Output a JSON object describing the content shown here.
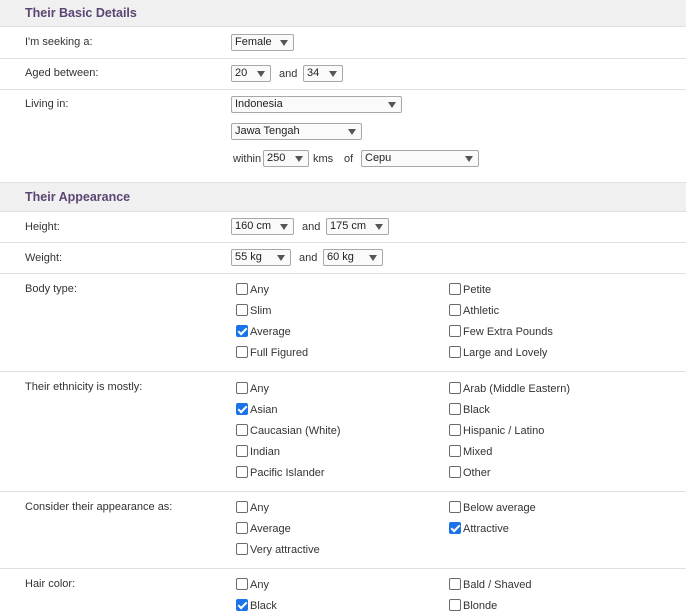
{
  "basic": {
    "title": "Their Basic Details",
    "seeking_label": "I'm seeking a:",
    "seeking_value": "Female",
    "aged_label": "Aged between:",
    "age_min": "20",
    "age_and": "and",
    "age_max": "34",
    "living_label": "Living in:",
    "country": "Indonesia",
    "region": "Jawa Tengah",
    "within_label": "within",
    "distance": "250",
    "kms_label": "kms",
    "of_label": "of",
    "city": "Cepu"
  },
  "appearance": {
    "title": "Their Appearance",
    "height_label": "Height:",
    "height_min": "160 cm",
    "height_and": "and",
    "height_max": "175 cm",
    "weight_label": "Weight:",
    "weight_min": "55 kg",
    "weight_and": "and",
    "weight_max": "60 kg",
    "body_label": "Body type:",
    "body_options": [
      {
        "label": "Any",
        "checked": false
      },
      {
        "label": "Petite",
        "checked": false
      },
      {
        "label": "Slim",
        "checked": false
      },
      {
        "label": "Athletic",
        "checked": false
      },
      {
        "label": "Average",
        "checked": true
      },
      {
        "label": "Few Extra Pounds",
        "checked": false
      },
      {
        "label": "Full Figured",
        "checked": false
      },
      {
        "label": "Large and Lovely",
        "checked": false
      }
    ],
    "ethnicity_label": "Their ethnicity is mostly:",
    "ethnicity_options": [
      {
        "label": "Any",
        "checked": false
      },
      {
        "label": "Arab (Middle Eastern)",
        "checked": false
      },
      {
        "label": "Asian",
        "checked": true
      },
      {
        "label": "Black",
        "checked": false
      },
      {
        "label": "Caucasian (White)",
        "checked": false
      },
      {
        "label": "Hispanic / Latino",
        "checked": false
      },
      {
        "label": "Indian",
        "checked": false
      },
      {
        "label": "Mixed",
        "checked": false
      },
      {
        "label": "Pacific Islander",
        "checked": false
      },
      {
        "label": "Other",
        "checked": false
      }
    ],
    "consider_label": "Consider their appearance as:",
    "consider_options": [
      {
        "label": "Any",
        "checked": false
      },
      {
        "label": "Below average",
        "checked": false
      },
      {
        "label": "Average",
        "checked": false
      },
      {
        "label": "Attractive",
        "checked": true
      },
      {
        "label": "Very attractive",
        "checked": false
      }
    ],
    "hair_label": "Hair color:",
    "hair_options": [
      {
        "label": "Any",
        "checked": false
      },
      {
        "label": "Bald / Shaved",
        "checked": false
      },
      {
        "label": "Black",
        "checked": true
      },
      {
        "label": "Blonde",
        "checked": false
      }
    ]
  },
  "colors": {
    "section_bg": "#f0f0f0",
    "section_title": "#5a4672",
    "checkbox_checked": "#1a73e8"
  }
}
